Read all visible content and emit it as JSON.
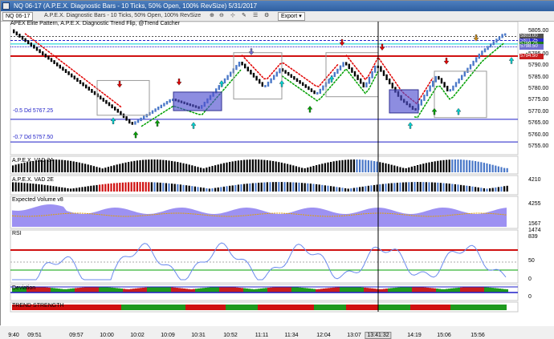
{
  "window": {
    "title": "NQ 06-17 (A.P.E.X. Diagnostic Bars - 10 Ticks, 50% Open, 100% RevSize)  5/31/2017"
  },
  "toolbar": {
    "instrument": "NQ 06-17",
    "chart_type": "A.P.E.X. Diagnostic Bars - 10 Ticks, 50% Open, 100% RevSize",
    "export_label": "Export",
    "export_icon": "chevron-down-icon"
  },
  "main_panel": {
    "indicators_label": "APEX Elite Pattern, A.P.E.X. Diagnostic Trend Flip, @Trend Catcher",
    "line_labels": [
      {
        "text": "-0.5 Dd 5767.25",
        "color": "#1e1ec8"
      },
      {
        "text": "-0.7 Dd 5757.50",
        "color": "#1e1ec8"
      }
    ],
    "price_axis": [
      "5805.00",
      "5795.00",
      "5790.00",
      "5785.00",
      "5780.00",
      "5775.00",
      "5770.00",
      "5765.00",
      "5760.00",
      "5755.00"
    ],
    "price_badges": [
      {
        "text": "5803.00",
        "color": "#505050"
      },
      {
        "text": "5801.25",
        "color": "#2a2ad0"
      },
      {
        "text": "5799.75",
        "color": "#1e7a1e"
      },
      {
        "text": "5798.50",
        "color": "#7070d0"
      },
      {
        "text": "5794.50",
        "color": "#c81e1e"
      }
    ]
  },
  "panels": [
    {
      "title": "A.P.E.X. VAD 2A",
      "axis": [
        "4210"
      ]
    },
    {
      "title": "A.P.E.X. VAD 2E",
      "axis": [
        "4255"
      ]
    },
    {
      "title": "Expected Volume v8",
      "axis": [
        "1567",
        "1474",
        "839"
      ]
    },
    {
      "title": "RSI",
      "axis": [
        "50",
        "0"
      ]
    },
    {
      "title": "Deviation",
      "axis": [
        "0"
      ]
    },
    {
      "title": "TREND STRENGTH",
      "axis": []
    }
  ],
  "time_axis": [
    "9:40",
    "09:51",
    "09:57",
    "10:00",
    "10:02",
    "10:09",
    "10:31",
    "10:52",
    "11:11",
    "11:34",
    "12:04",
    "13:07",
    "13:41:32",
    "14:19",
    "15:06",
    "15:56"
  ],
  "cursor_time": "13:41:32",
  "colors": {
    "up_bar": "#4a78c8",
    "down_bar": "#000000",
    "trend_up": "#00a000",
    "trend_down": "#e00000",
    "level_blue": "#1e1ec8",
    "level_red": "#d01010",
    "cyan": "#00d0d0",
    "volume": "#8c7ef0"
  }
}
